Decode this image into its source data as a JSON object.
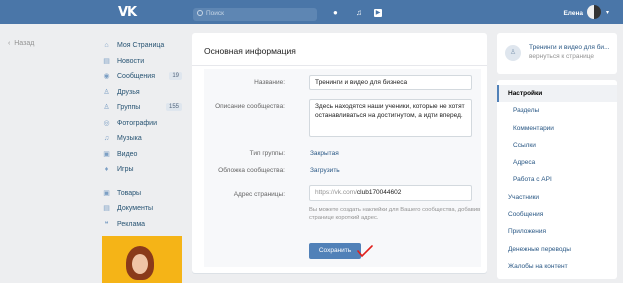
{
  "topbar": {
    "logo": "VK",
    "search_placeholder": "Поиск",
    "user_name": "Елена",
    "icons": [
      "bell-icon",
      "music-icon",
      "play-icon"
    ]
  },
  "back_link": "Назад",
  "leftnav": {
    "items": [
      {
        "label": "Моя Страница",
        "icon": "home-icon"
      },
      {
        "label": "Новости",
        "icon": "news-icon"
      },
      {
        "label": "Сообщения",
        "icon": "chat-icon",
        "count": "19"
      },
      {
        "label": "Друзья",
        "icon": "user-icon"
      },
      {
        "label": "Группы",
        "icon": "group-icon",
        "count": "155"
      },
      {
        "label": "Фотографии",
        "icon": "camera-icon"
      },
      {
        "label": "Музыка",
        "icon": "music-icon"
      },
      {
        "label": "Видео",
        "icon": "video-icon"
      },
      {
        "label": "Игры",
        "icon": "game-icon"
      }
    ],
    "items2": [
      {
        "label": "Товары",
        "icon": "bag-icon"
      },
      {
        "label": "Документы",
        "icon": "document-icon"
      },
      {
        "label": "Реклама",
        "icon": "megaphone-icon"
      }
    ]
  },
  "main": {
    "title": "Основная информация",
    "name_label": "Название:",
    "name_value": "Тренинги и видео для бизнеса",
    "desc_label": "Описание сообщества:",
    "desc_value": "Здесь находятся наши ученики, которые не хотят останавливаться на достигнутом, а идти вперед.",
    "type_label": "Тип группы:",
    "type_value": "Закрытая",
    "cover_label": "Обложка сообщества:",
    "cover_value": "Загрузить",
    "address_label": "Адрес страницы:",
    "address_prefix": "https://vk.com/",
    "address_value": "club170044602",
    "hint": "Вы можете создать наклейки для Вашего сообщества, добавив странице короткий адрес.",
    "save_label": "Сохранить"
  },
  "rightcol": {
    "group_title": "Тренинги и видео для би...",
    "group_sub": "вернуться к странице",
    "menu": [
      {
        "label": "Настройки",
        "type": "active"
      },
      {
        "label": "Разделы",
        "type": "sub"
      },
      {
        "label": "Комментарии",
        "type": "sub"
      },
      {
        "label": "Ссылки",
        "type": "sub"
      },
      {
        "label": "Адреса",
        "type": "sub"
      },
      {
        "label": "Работа с API",
        "type": "sub"
      },
      {
        "label": "Участники",
        "type": "top"
      },
      {
        "label": "Сообщения",
        "type": "top"
      },
      {
        "label": "Приложения",
        "type": "top"
      },
      {
        "label": "Денежные переводы",
        "type": "top"
      },
      {
        "label": "Жалобы на контент",
        "type": "top"
      }
    ]
  },
  "colors": {
    "header": "#4a76a8",
    "button": "#5181b8",
    "link": "#2a5885",
    "checkmark": "#e0201c"
  }
}
